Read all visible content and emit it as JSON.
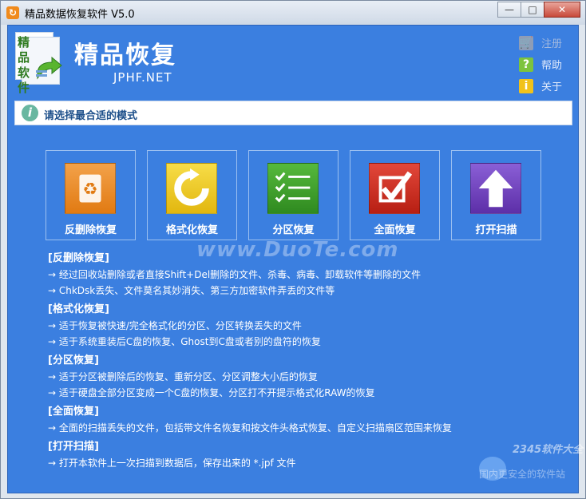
{
  "window": {
    "title": "精品数据恢复软件 V5.0",
    "icon": "app-icon",
    "buttons": {
      "minimize": "—",
      "maximize": "□",
      "close": "✕"
    }
  },
  "header": {
    "logo_text": "精品软件",
    "brand_title": "精品恢复",
    "brand_sub": "JPHF.NET"
  },
  "side_links": [
    {
      "label": "注册",
      "icon": "cart-icon",
      "dim": true
    },
    {
      "label": "帮助",
      "icon": "help-icon",
      "dim": false
    },
    {
      "label": "关于",
      "icon": "info-icon",
      "dim": false
    }
  ],
  "hint": {
    "text": "请选择最合适的模式"
  },
  "tiles": [
    {
      "label": "反删除恢复",
      "icon": "recycle-icon",
      "color": "#e9861f"
    },
    {
      "label": "格式化恢复",
      "icon": "refresh-icon",
      "color": "#e8c317"
    },
    {
      "label": "分区恢复",
      "icon": "checklist-icon",
      "color": "#3f9f2c"
    },
    {
      "label": "全面恢复",
      "icon": "check-icon",
      "color": "#cf2b1d"
    },
    {
      "label": "打开扫描",
      "icon": "up-arrow-icon",
      "color": "#6f3fb9"
    }
  ],
  "descriptions": [
    {
      "title": "[反删除恢复]",
      "lines": [
        "→ 经过回收站删除或者直接Shift+Del删除的文件、杀毒、病毒、卸载软件等删除的文件",
        "→ ChkDsk丢失、文件莫名其妙消失、第三方加密软件弄丢的文件等"
      ]
    },
    {
      "title": "[格式化恢复]",
      "lines": [
        "→ 适于恢复被快速/完全格式化的分区、分区转换丢失的文件",
        "→ 适于系统重装后C盘的恢复、Ghost到C盘或者别的盘符的恢复"
      ]
    },
    {
      "title": "[分区恢复]",
      "lines": [
        "→ 适于分区被删除后的恢复、重新分区、分区调整大小后的恢复",
        "→ 适于硬盘全部分区变成一个C盘的恢复、分区打不开提示格式化RAW的恢复"
      ]
    },
    {
      "title": "[全面恢复]",
      "lines": [
        "→ 全面的扫描丢失的文件，包括带文件名恢复和按文件头格式恢复、自定义扫描扇区范围来恢复"
      ]
    },
    {
      "title": "[打开扫描]",
      "lines": [
        "→ 打开本软件上一次扫描到数据后，保存出来的 *.jpf 文件"
      ]
    }
  ],
  "watermarks": {
    "center": "www.DuoTe.com",
    "corner_a": "2345软件大全",
    "corner_b": "国内更安全的软件站"
  }
}
